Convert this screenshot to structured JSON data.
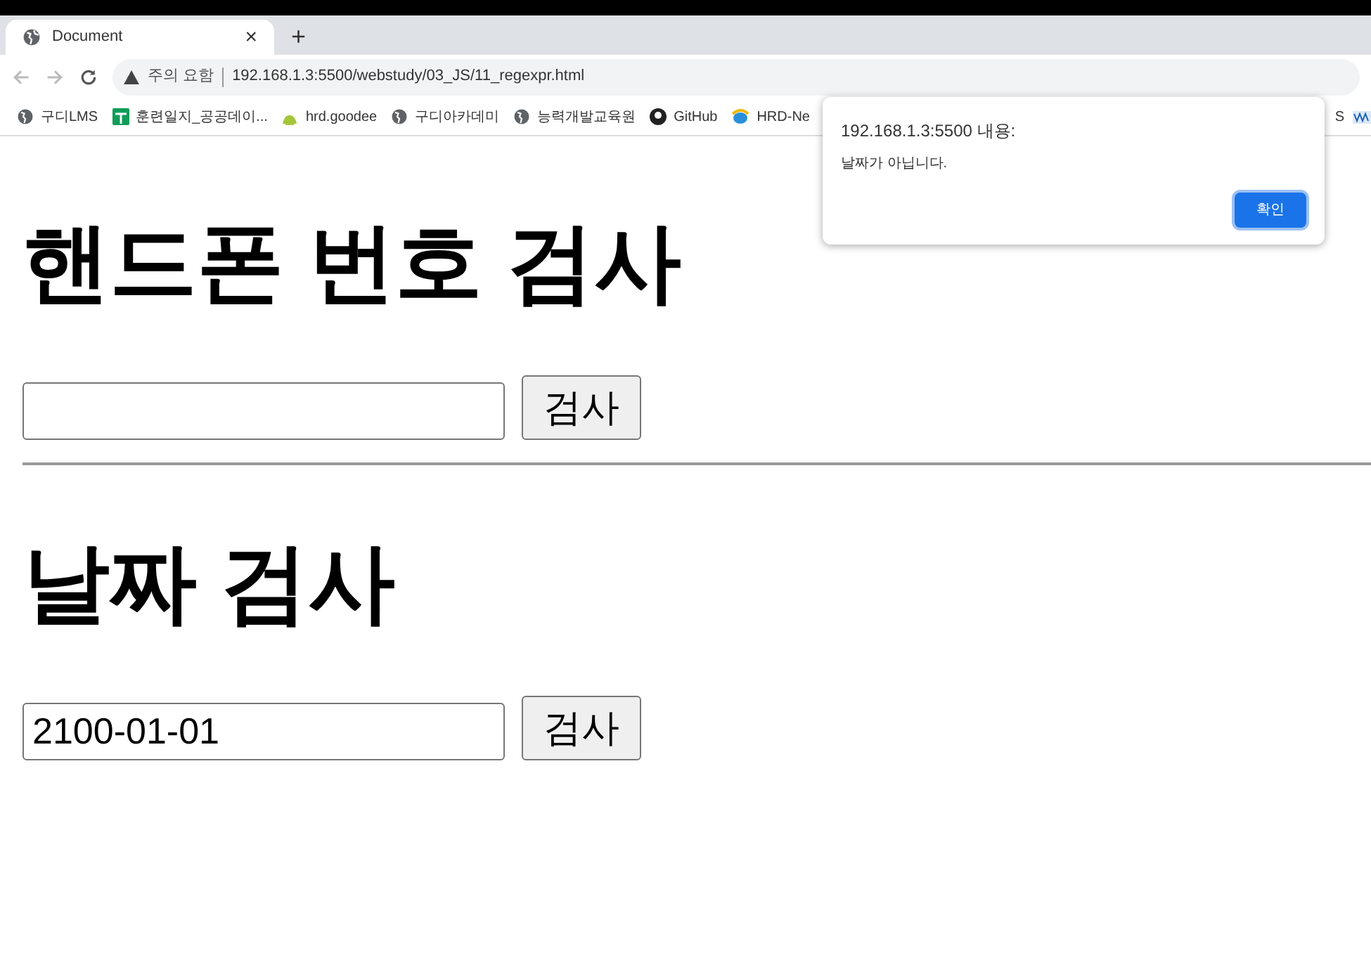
{
  "tab": {
    "title": "Document",
    "close": "×",
    "new_tab": "+"
  },
  "address_bar": {
    "security": "주의 요함",
    "url": "192.168.1.3:5500/webstudy/03_JS/11_regexpr.html"
  },
  "bookmarks": [
    {
      "label": "구디LMS",
      "kind": "globe"
    },
    {
      "label": "훈련일지_공공데이...",
      "kind": "sheet"
    },
    {
      "label": "hrd.goodee",
      "kind": "android"
    },
    {
      "label": "구디아카데미",
      "kind": "globe"
    },
    {
      "label": "능력개발교육원",
      "kind": "globe"
    },
    {
      "label": "GitHub",
      "kind": "github"
    },
    {
      "label": "HRD-Ne",
      "kind": "ie"
    }
  ],
  "bookmarks_right": {
    "label": "S"
  },
  "sections": [
    {
      "heading": "핸드폰 번호 검사",
      "button": "검사"
    },
    {
      "heading": "날짜 검사",
      "value": "2100-01-01",
      "button": "검사"
    }
  ],
  "dialog": {
    "title": "192.168.1.3:5500 내용:",
    "message": "날짜가 아닙니다.",
    "ok": "확인"
  }
}
